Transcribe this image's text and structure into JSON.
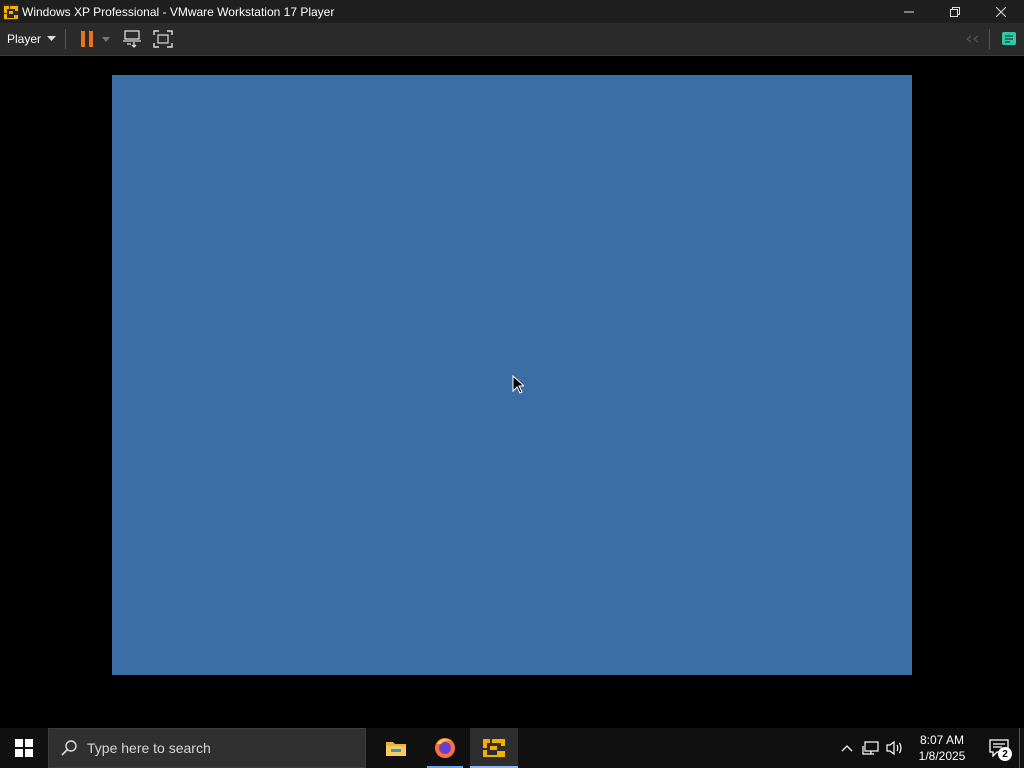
{
  "window": {
    "title": "Windows XP Professional - VMware Workstation 17 Player",
    "minimize_icon": "minimize-icon",
    "restore_icon": "restore-icon",
    "close_icon": "close-icon"
  },
  "toolbar": {
    "player_menu_label": "Player",
    "buttons": [
      "pause-icon",
      "send-ctrl-alt-del-icon",
      "fullscreen-icon"
    ],
    "right_buttons": [
      "back-icon",
      "notes-icon"
    ],
    "accent_pause": "#e8731e",
    "accent_notes": "#31c7a8"
  },
  "guest": {
    "background_color": "#3a6ea5"
  },
  "taskbar": {
    "search_placeholder": "Type here to search",
    "pinned": [
      "file-explorer-icon",
      "firefox-icon",
      "vmware-player-icon"
    ],
    "clock_time": "8:07 AM",
    "clock_date": "1/8/2025",
    "notification_count": "2"
  }
}
